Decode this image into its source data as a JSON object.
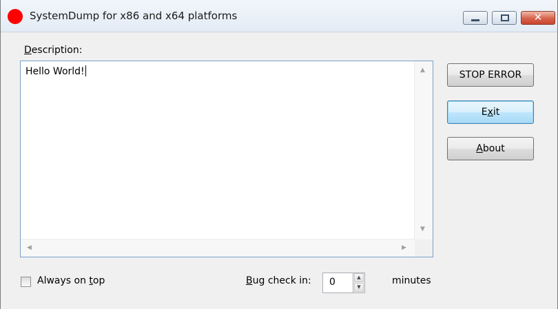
{
  "window": {
    "title": "SystemDump for x86 and x64 platforms",
    "app_icon": "red-circle-icon",
    "caption_buttons": {
      "minimize": "minimize-icon",
      "maximize": "maximize-icon",
      "close": "✕"
    }
  },
  "description": {
    "label_accel": "D",
    "label_rest": "escription:",
    "value": "Hello World!"
  },
  "buttons": {
    "stop_error": "STOP ERROR",
    "exit_pre": "E",
    "exit_accel": "x",
    "exit_post": "it",
    "about_accel": "A",
    "about_rest": "bout"
  },
  "always_on_top": {
    "label_pre": "Always on ",
    "label_accel": "t",
    "label_post": "op",
    "checked": false
  },
  "bug_check": {
    "label_accel": "B",
    "label_rest": "ug check in:",
    "value": "0",
    "unit": "minutes"
  },
  "colors": {
    "app_icon": "#ff0000",
    "focused_border": "#3c7fb1",
    "close_button": "#c7452f"
  }
}
